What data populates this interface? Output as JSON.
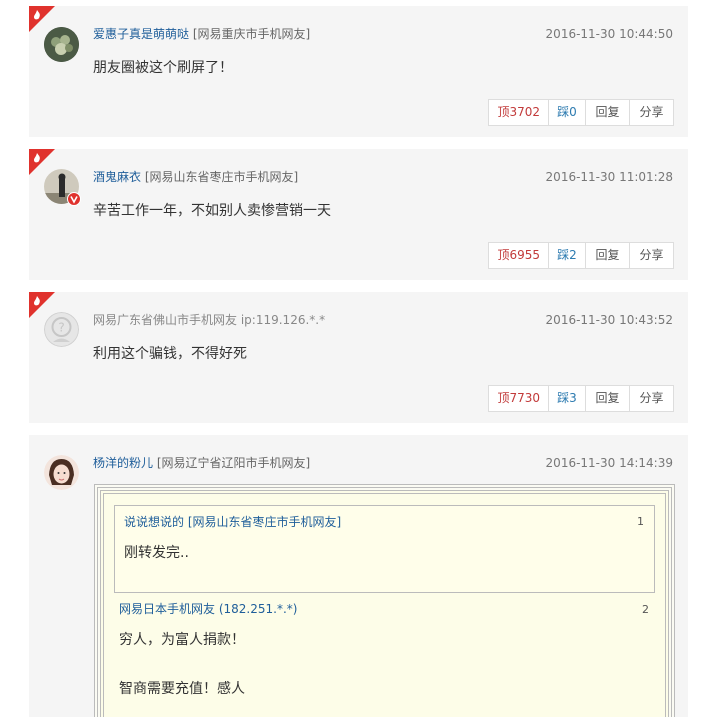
{
  "comments": [
    {
      "user": "爱惠子真是萌萌哒",
      "location": "[网易重庆市手机网友]",
      "time": "2016-11-30 10:44:50",
      "text": "朋友圈被这个刷屏了！",
      "up": "顶3702",
      "down": "踩0",
      "reply": "回复",
      "share": "分享"
    },
    {
      "user": "酒鬼麻衣",
      "location": "[网易山东省枣庄市手机网友]",
      "time": "2016-11-30 11:01:28",
      "text": "辛苦工作一年，不如别人卖惨营销一天",
      "up": "顶6955",
      "down": "踩2",
      "reply": "回复",
      "share": "分享"
    },
    {
      "location": "网易广东省佛山市手机网友",
      "ip": "ip:119.126.*.*",
      "time": "2016-11-30 10:43:52",
      "text": "利用这个骗钱，不得好死",
      "up": "顶7730",
      "down": "踩3",
      "reply": "回复",
      "share": "分享"
    },
    {
      "user": "杨洋的粉儿",
      "location": "[网易辽宁省辽阳市手机网友]",
      "time": "2016-11-30 14:14:39",
      "quotes": [
        {
          "user": "说说想说的",
          "location": "[网易山东省枣庄市手机网友]",
          "num": "1",
          "text": "刚转发完.."
        },
        {
          "location": "网易日本手机网友",
          "ip": "(182.251.*.*)",
          "num": "2",
          "text": "穷人，为富人捐款！",
          "text2": "智商需要充值！感人"
        }
      ]
    }
  ]
}
